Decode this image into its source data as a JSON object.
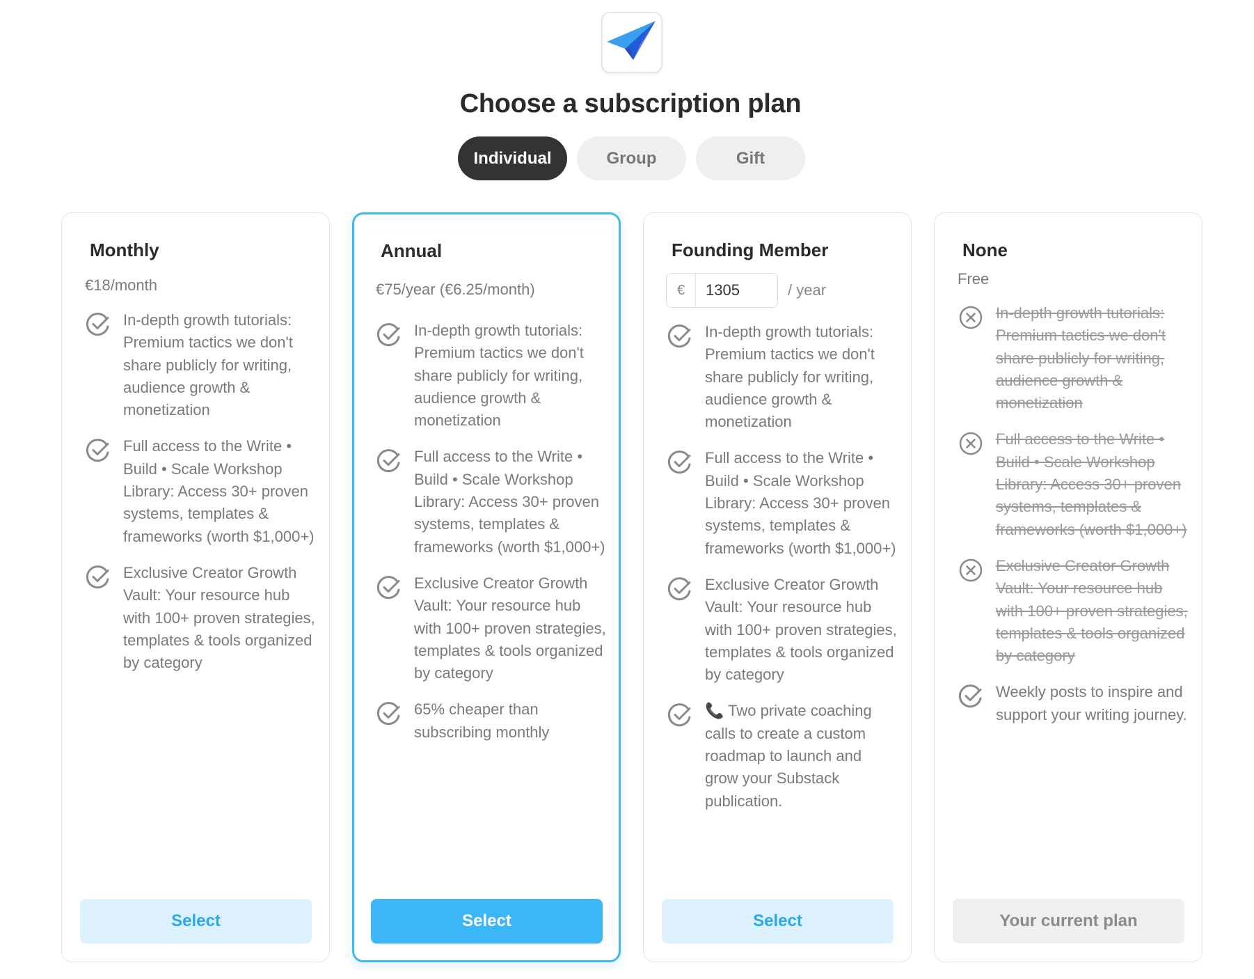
{
  "header": {
    "title": "Choose a subscription plan",
    "logo_icon": "paper-plane-icon"
  },
  "tabs": [
    {
      "label": "Individual",
      "active": true
    },
    {
      "label": "Group",
      "active": false
    },
    {
      "label": "Gift",
      "active": false
    }
  ],
  "colors": {
    "accent": "#3bb7f7",
    "accent_light": "#dcf1fd",
    "dark_tab": "#333333"
  },
  "plans": [
    {
      "name": "Monthly",
      "price": "€18/month",
      "features": [
        {
          "icon": "check-circle-icon",
          "text": "In-depth growth tutorials: Premium tactics we don't share publicly for writing, audience growth & monetization"
        },
        {
          "icon": "check-circle-icon",
          "text": "Full access to the Write • Build • Scale Workshop Library: Access 30+ proven systems, templates & frameworks (worth $1,000+)"
        },
        {
          "icon": "check-circle-icon",
          "text": "Exclusive Creator Growth Vault: Your resource hub with 100+ proven strategies, templates & tools organized by category"
        }
      ],
      "button": "Select"
    },
    {
      "name": "Annual",
      "price": "€75/year (€6.25/month)",
      "highlighted": true,
      "features": [
        {
          "icon": "check-circle-icon",
          "text": "In-depth growth tutorials: Premium tactics we don't share publicly for writing, audience growth & monetization"
        },
        {
          "icon": "check-circle-icon",
          "text": "Full access to the Write • Build • Scale Workshop Library: Access 30+ proven systems, templates & frameworks (worth $1,000+)"
        },
        {
          "icon": "check-circle-icon",
          "text": "Exclusive Creator Growth Vault: Your resource hub with 100+ proven strategies, templates & tools organized by category"
        },
        {
          "icon": "check-circle-icon",
          "text": "65% cheaper than subscribing monthly"
        }
      ],
      "button": "Select"
    },
    {
      "name": "Founding Member",
      "currency": "€",
      "amount": "1305",
      "period": "/ year",
      "features": [
        {
          "icon": "check-circle-icon",
          "text": "In-depth growth tutorials: Premium tactics we don't share publicly for writing, audience growth & monetization"
        },
        {
          "icon": "check-circle-icon",
          "text": "Full access to the Write • Build • Scale Workshop Library: Access 30+ proven systems, templates & frameworks (worth $1,000+)"
        },
        {
          "icon": "check-circle-icon",
          "text": "Exclusive Creator Growth Vault: Your resource hub with 100+ proven strategies, templates & tools organized by category"
        },
        {
          "icon": "check-circle-icon",
          "text": "📞 Two private coaching calls to create a custom roadmap to launch and grow your Substack publication."
        }
      ],
      "button": "Select"
    },
    {
      "name": "None",
      "price": "Free",
      "features": [
        {
          "icon": "x-circle-icon",
          "text": "In-depth growth tutorials: Premium tactics we don't share publicly for writing, audience growth & monetization",
          "struck": true
        },
        {
          "icon": "x-circle-icon",
          "text": "Full access to the Write • Build • Scale Workshop Library: Access 30+ proven systems, templates & frameworks (worth $1,000+)",
          "struck": true
        },
        {
          "icon": "x-circle-icon",
          "text": "Exclusive Creator Growth Vault: Your resource hub with 100+ proven strategies, templates & tools organized by category",
          "struck": true
        },
        {
          "icon": "check-circle-icon",
          "text": "Weekly posts to inspire and support your writing journey."
        }
      ],
      "button": "Your current plan"
    }
  ]
}
